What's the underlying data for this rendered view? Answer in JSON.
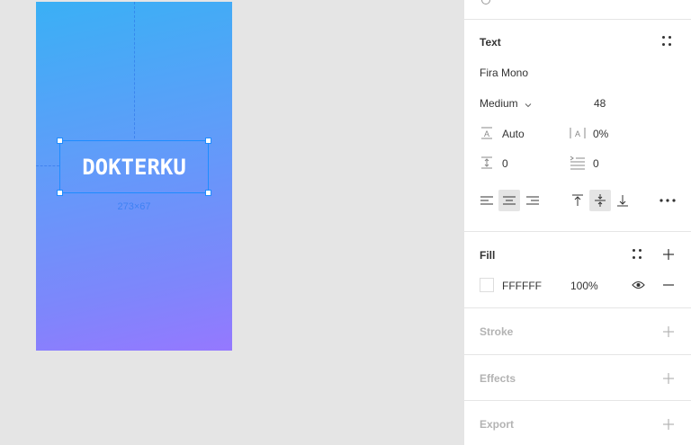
{
  "canvas": {
    "frame": {
      "layer_text": "DOKTERKU",
      "size_label": "273×67"
    }
  },
  "panel": {
    "text_section": {
      "title": "Text",
      "font_family": "Fira Mono",
      "font_weight": "Medium",
      "font_size": "48",
      "line_height": "Auto",
      "letter_spacing": "0%",
      "paragraph_spacing": "0",
      "paragraph_indent": "0",
      "align_horizontal_selected": "center",
      "align_vertical_selected": "middle"
    },
    "fill_section": {
      "title": "Fill",
      "color_hex": "FFFFFF",
      "opacity": "100%",
      "swatch_color": "#ffffff"
    },
    "stroke_section": {
      "title": "Stroke"
    },
    "effects_section": {
      "title": "Effects"
    },
    "export_section": {
      "title": "Export"
    }
  },
  "colors": {
    "selection": "#1e8cff",
    "gradient_start": "#3ab0f5",
    "gradient_end": "#9578ff"
  }
}
